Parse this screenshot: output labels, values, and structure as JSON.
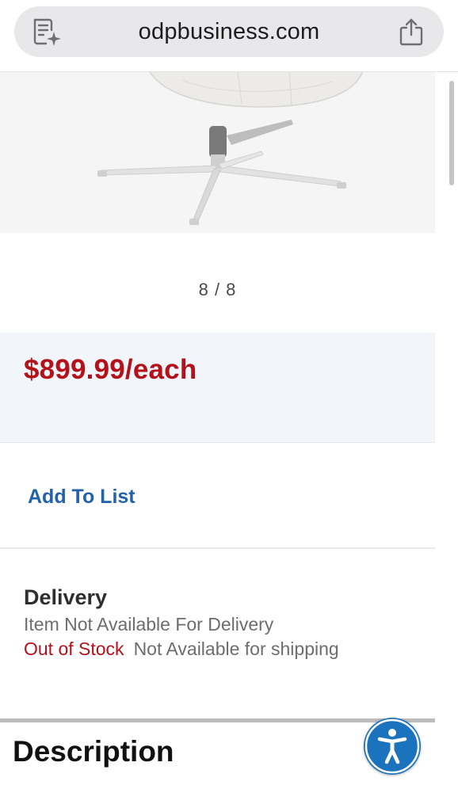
{
  "browser": {
    "url": "odpbusiness.com",
    "reader_icon": "reader-mode-icon",
    "share_icon": "share-icon"
  },
  "product_gallery": {
    "counter": "8 / 8"
  },
  "pricing": {
    "price": "$899.99/each",
    "price_color": "#b3121b"
  },
  "actions": {
    "add_to_list": "Add To List",
    "link_color": "#2262a8"
  },
  "delivery": {
    "title": "Delivery",
    "status": "Item Not Available For Delivery",
    "stock": "Out of Stock",
    "shipping": "Not Available for shipping"
  },
  "description": {
    "title": "Description"
  },
  "accessibility": {
    "icon": "accessibility-icon",
    "color": "#1b72bd"
  }
}
